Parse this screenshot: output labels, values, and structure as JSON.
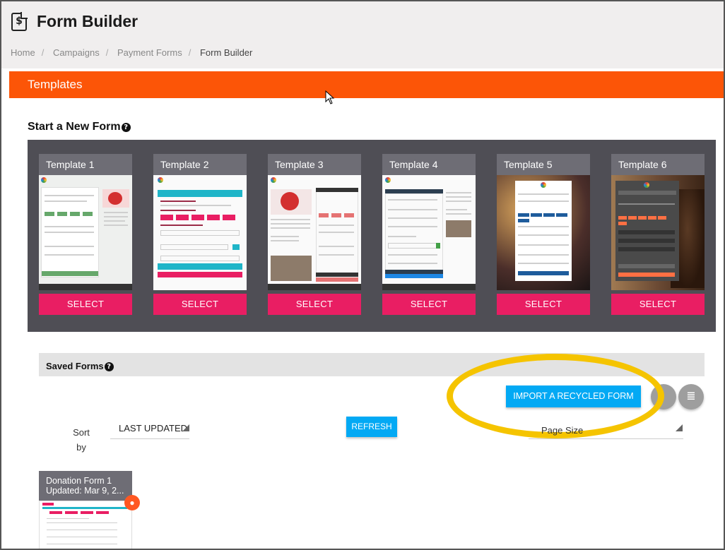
{
  "header": {
    "app_icon": "dollar-document-icon",
    "app_icon_glyph": "$",
    "title": "Form Builder"
  },
  "breadcrumb": [
    "Home",
    "Campaigns",
    "Payment Forms",
    "Form Builder"
  ],
  "templates_section": {
    "title": "Templates",
    "start_title": "Start a New Form",
    "help_glyph": "?",
    "templates": [
      {
        "name": "Template 1",
        "button": "SELECT"
      },
      {
        "name": "Template 2",
        "button": "SELECT"
      },
      {
        "name": "Template 3",
        "button": "SELECT"
      },
      {
        "name": "Template 4",
        "button": "SELECT"
      },
      {
        "name": "Template 5",
        "button": "SELECT"
      },
      {
        "name": "Template 6",
        "button": "SELECT"
      }
    ]
  },
  "saved_forms": {
    "title": "Saved Forms",
    "import_button": "IMPORT A RECYCLED FORM",
    "refresh_button": "REFRESH",
    "sort_label": "Sort by",
    "sort_value": "LAST UPDATED",
    "page_size_label": "Page Size",
    "list_view_glyph": "≣",
    "forms": [
      {
        "name": "Donation Form 1",
        "updated": "Updated: Mar 9, 2..."
      }
    ]
  },
  "colors": {
    "orange": "#fc5507",
    "pink": "#e91e63",
    "blue": "#03a9f4",
    "panel": "#4f4e55",
    "highlight": "#f5c400"
  }
}
